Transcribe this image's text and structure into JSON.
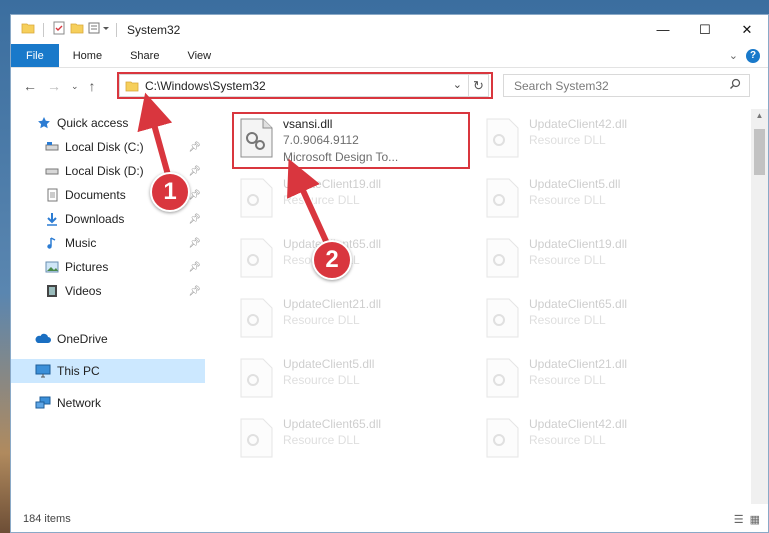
{
  "window": {
    "title": "System32",
    "controls": {
      "minimize": "—",
      "maximize": "☐",
      "close": "✕"
    }
  },
  "ribbon": {
    "tabs": [
      "File",
      "Home",
      "Share",
      "View"
    ]
  },
  "address": {
    "path": "C:\\Windows\\System32",
    "search_placeholder": "Search System32"
  },
  "nav_pane": {
    "items": [
      {
        "label": "Quick access",
        "icon": "star-icon",
        "pinned": false
      },
      {
        "label": "Local Disk (C:)",
        "icon": "drive-icon",
        "pinned": true
      },
      {
        "label": "Local Disk (D:)",
        "icon": "drive-icon",
        "pinned": true
      },
      {
        "label": "Documents",
        "icon": "documents-icon",
        "pinned": true
      },
      {
        "label": "Downloads",
        "icon": "download-icon",
        "pinned": true
      },
      {
        "label": "Music",
        "icon": "music-icon",
        "pinned": true
      },
      {
        "label": "Pictures",
        "icon": "pictures-icon",
        "pinned": true
      },
      {
        "label": "Videos",
        "icon": "videos-icon",
        "pinned": true
      },
      {
        "label": "OneDrive",
        "icon": "cloud-icon",
        "pinned": false
      },
      {
        "label": "This PC",
        "icon": "monitor-icon",
        "pinned": false,
        "selected": true
      },
      {
        "label": "Network",
        "icon": "network-icon",
        "pinned": false
      }
    ]
  },
  "files": [
    {
      "name": "vsansi.dll",
      "line1": "7.0.9064.9112",
      "line2": "Microsoft Design To...",
      "highlighted": true
    },
    {
      "name": "UpdateClient42.dll",
      "line1": "Resource DLL",
      "line2": ""
    },
    {
      "name": "UpdateClient19.dll",
      "line1": "Resource DLL",
      "line2": ""
    },
    {
      "name": "UpdateClient5.dll",
      "line1": "Resource DLL",
      "line2": ""
    },
    {
      "name": "UpdateClient65.dll",
      "line1": "Resource DLL",
      "line2": ""
    },
    {
      "name": "UpdateClient19.dll",
      "line1": "Resource DLL",
      "line2": ""
    },
    {
      "name": "UpdateClient21.dll",
      "line1": "Resource DLL",
      "line2": ""
    },
    {
      "name": "UpdateClient65.dll",
      "line1": "Resource DLL",
      "line2": ""
    },
    {
      "name": "UpdateClient5.dll",
      "line1": "Resource DLL",
      "line2": ""
    },
    {
      "name": "UpdateClient21.dll",
      "line1": "Resource DLL",
      "line2": ""
    },
    {
      "name": "UpdateClient65.dll",
      "line1": "Resource DLL",
      "line2": ""
    },
    {
      "name": "UpdateClient42.dll",
      "line1": "Resource DLL",
      "line2": ""
    }
  ],
  "status": {
    "item_count": "184 items"
  },
  "annotations": {
    "step1": "1",
    "step2": "2"
  },
  "colors": {
    "accent": "#1979ca",
    "annotation": "#d9363e",
    "selection": "#cce8ff"
  }
}
